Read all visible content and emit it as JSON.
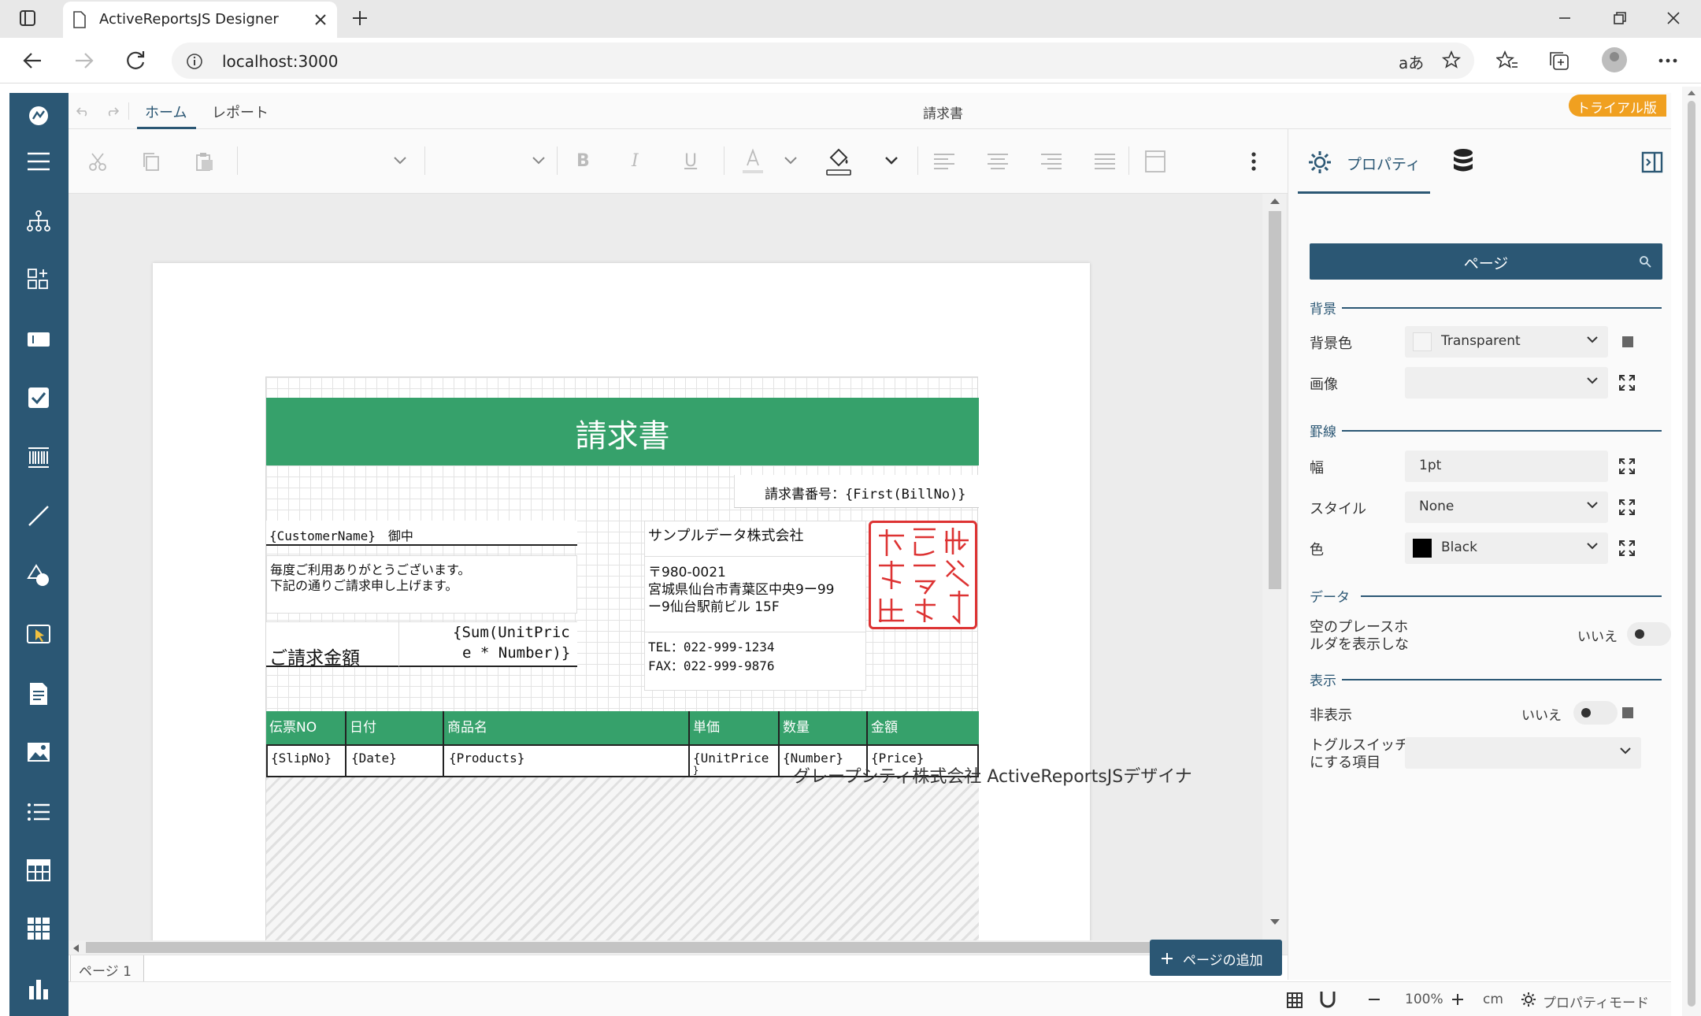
{
  "browser": {
    "tab_title": "ActiveReportsJS Designer",
    "url": "localhost:3000"
  },
  "menu": {
    "tabs": [
      "ホーム",
      "レポート"
    ],
    "document_title": "請求書",
    "trial_badge": "トライアル版"
  },
  "rpanel": {
    "tab_label": "プロパティ",
    "search_value": "ページ",
    "sections": {
      "background": "背景",
      "border": "罫線",
      "data": "データ",
      "display": "表示"
    },
    "props": {
      "bg_color_label": "背景色",
      "bg_color_value": "Transparent",
      "image_label": "画像",
      "width_label": "幅",
      "width_value": "1pt",
      "style_label": "スタイル",
      "style_value": "None",
      "color_label": "色",
      "color_value": "Black",
      "empty_label": "空のプレースホ\nルダを表示しな",
      "empty_value": "いいえ",
      "hidden_label": "非表示",
      "hidden_value": "いいえ",
      "toggle_item_label": "トグルスイッチ\nにする項目"
    }
  },
  "report": {
    "title": "請求書",
    "bill_no": "請求書番号：{First(BillNo)}",
    "customer": "{CustomerName}　御中",
    "greeting_1": "毎度ご利用ありがとうございます。",
    "greeting_2": "下記の通りご請求申し上げます。",
    "amount_label": "ご請求金額",
    "amount_expr_1": "{Sum(UnitPric",
    "amount_expr_2": "e * Number)}",
    "company_name": "サンプルデータ株式会社",
    "company_zip": "〒980-0021",
    "company_addr_1": "宮城県仙台市青葉区中央9ー99",
    "company_addr_2": "ー9仙台駅前ビル 15F",
    "tel": "TEL：022-999-1234",
    "fax": "FAX：022-999-9876",
    "stamp_text": "サンプルデータ株式会社",
    "table_headers": [
      "伝票NO",
      "日付",
      "商品名",
      "単価",
      "数量",
      "金額"
    ],
    "table_row": [
      "{SlipNo}",
      "{Date}",
      "{Products}",
      "{UnitPrice",
      "{Number}",
      "{Price}"
    ],
    "table_row_extra": "}",
    "footer": "グレープシティ株式会社 ActiveReportsJSデザイナ",
    "accent": "#36a16b"
  },
  "bottom": {
    "page_tab": "ページ 1",
    "add_page": "ページの追加",
    "zoom": "100%",
    "unit": "cm",
    "mode": "プロパティモード"
  },
  "colors": {
    "sidebar": "#2b5774",
    "accent_green": "#36a16b",
    "badge": "#f0a020"
  }
}
